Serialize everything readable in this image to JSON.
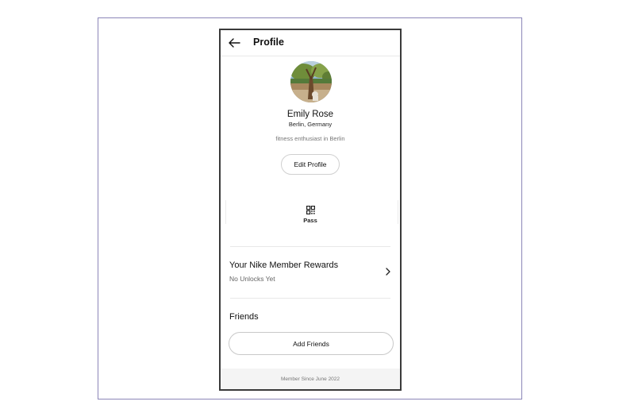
{
  "header": {
    "title": "Profile",
    "back_icon": "arrow-left-icon"
  },
  "profile": {
    "name": "Emily Rose",
    "location": "Berlin, Germany",
    "bio": "fitness enthusiast in Berlin",
    "edit_label": "Edit Profile"
  },
  "pass": {
    "label": "Pass",
    "icon": "qr-code-icon"
  },
  "rewards": {
    "title": "Your Nike Member Rewards",
    "subtitle": "No Unlocks Yet",
    "icon": "chevron-right-icon"
  },
  "friends": {
    "heading": "Friends",
    "add_label": "Add Friends"
  },
  "footer": {
    "member_since": "Member Since June 2022"
  },
  "colors": {
    "frame_border": "#8b86b8",
    "phone_border": "#3a3a3a",
    "footer_bg": "#f4f4f4",
    "muted_text": "#777777"
  }
}
